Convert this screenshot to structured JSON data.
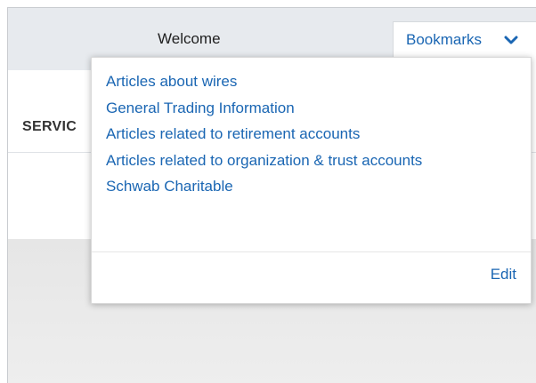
{
  "header": {
    "welcome_label": "Welcome",
    "bookmarks_label": "Bookmarks"
  },
  "nav": {
    "services_label": "SERVIC"
  },
  "bookmarks_menu": {
    "items": [
      {
        "label": "Articles about wires"
      },
      {
        "label": "General Trading Information"
      },
      {
        "label": "Articles related to retirement accounts"
      },
      {
        "label": "Articles related to organization & trust accounts"
      },
      {
        "label": "Schwab Charitable"
      }
    ],
    "edit_label": "Edit"
  },
  "icons": {
    "bookmarks_toggle": "chevron-down-icon"
  },
  "colors": {
    "link_blue": "#1a66b3",
    "header_bg": "#e7eaee",
    "content_bg": "#e9e9e9"
  }
}
